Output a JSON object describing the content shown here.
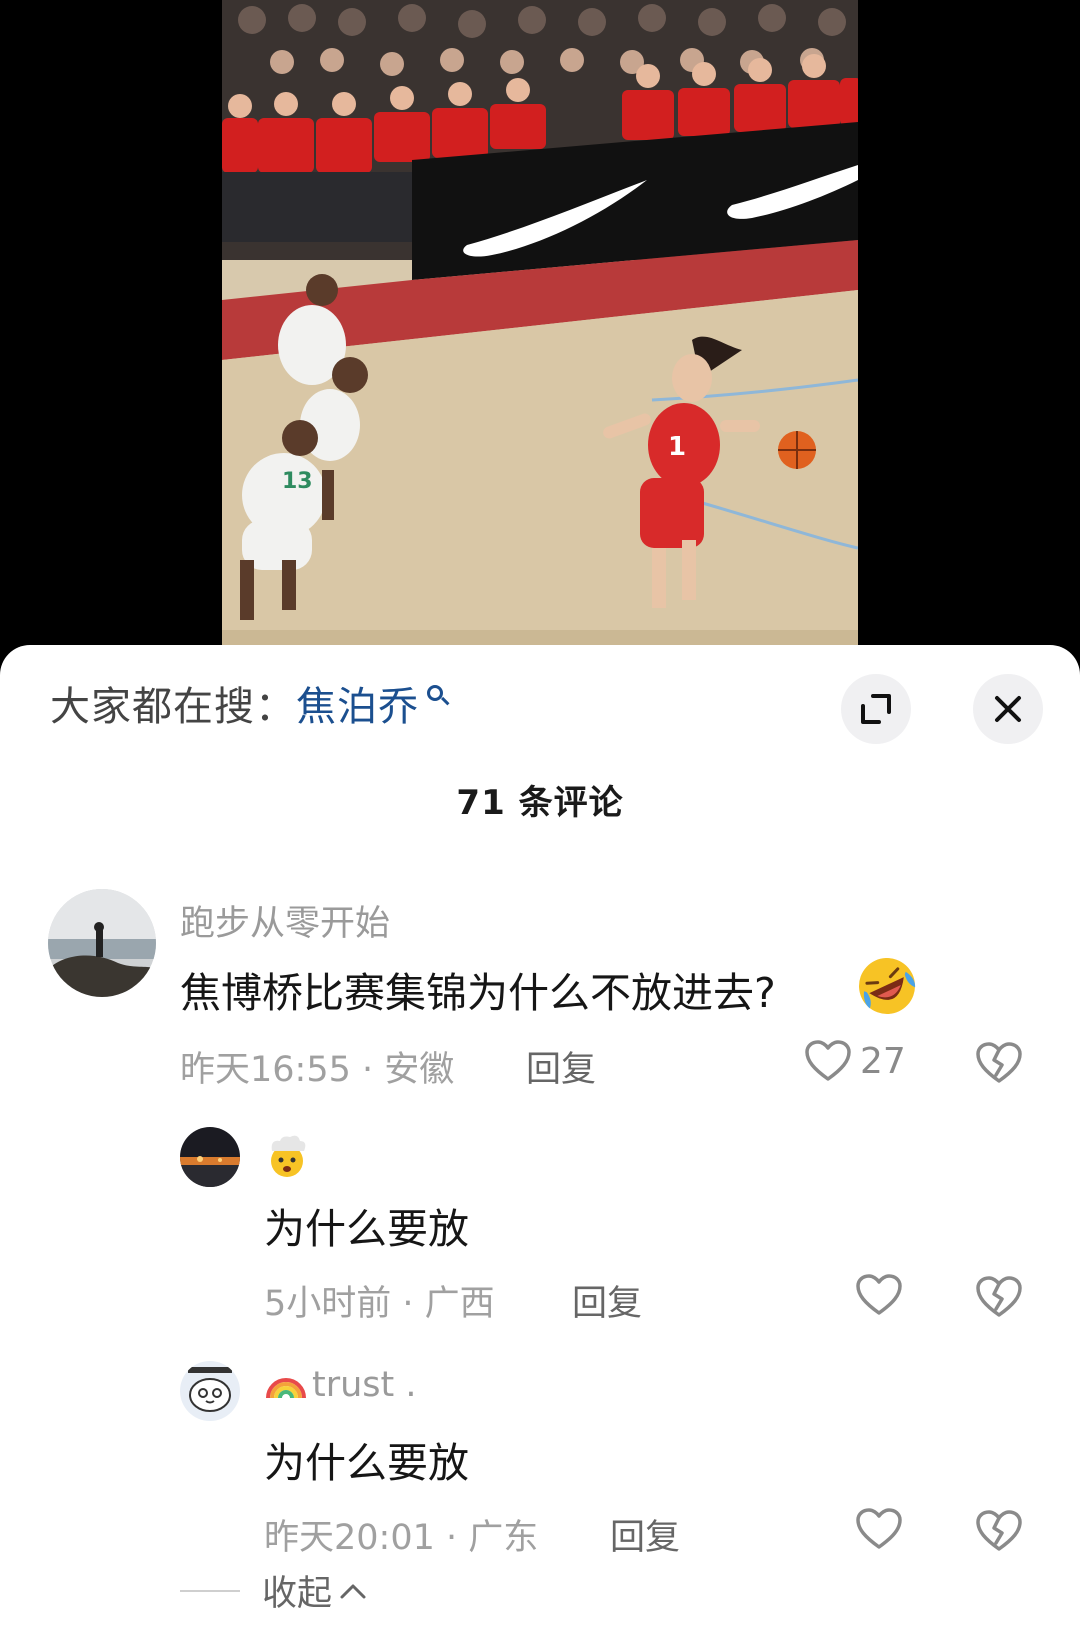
{
  "search": {
    "prefix": "大家都在搜：",
    "term": "焦泊乔"
  },
  "comments_header": {
    "count_label": "71 条评论"
  },
  "comments": [
    {
      "username": "跑步从零开始",
      "text": "焦博桥比赛集锦为什么不放进去?",
      "meta": "昨天16:55 · 安徽",
      "reply_label": "回复",
      "likes": "27",
      "emoji": "rolling-on-floor-laughing"
    }
  ],
  "replies": [
    {
      "username_emoji": "exploding-head",
      "text": "为什么要放",
      "meta": "5小时前 · 广西",
      "reply_label": "回复"
    },
    {
      "username": "trust .",
      "text": "为什么要放",
      "meta": "昨天20:01 · 广东",
      "reply_label": "回复"
    }
  ],
  "collapse_label": "收起",
  "colors": {
    "link_blue": "#1b4f8f",
    "sheet_bg": "#ffffff",
    "meta_gray": "#a0a0a0"
  }
}
